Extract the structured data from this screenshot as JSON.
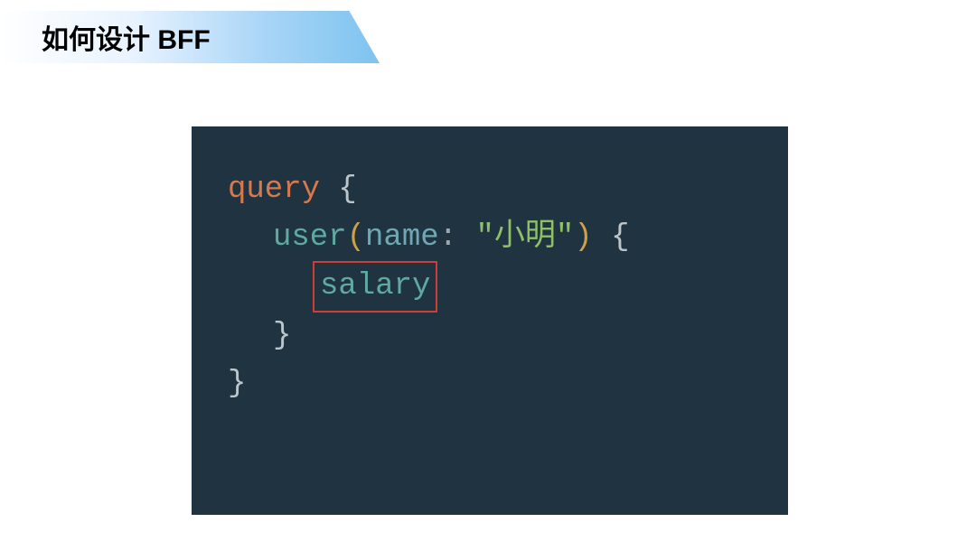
{
  "title": "如何设计 BFF",
  "code": {
    "line1_keyword": "query",
    "line1_brace": " {",
    "line2_field": "user",
    "line2_open_paren": "(",
    "line2_argname": "name",
    "line2_colon": ": ",
    "line2_string": "\"小明\"",
    "line2_close_paren": ")",
    "line2_brace": " {",
    "line3_boxed": "salary",
    "line4_brace": "}",
    "line5_brace": "}"
  }
}
